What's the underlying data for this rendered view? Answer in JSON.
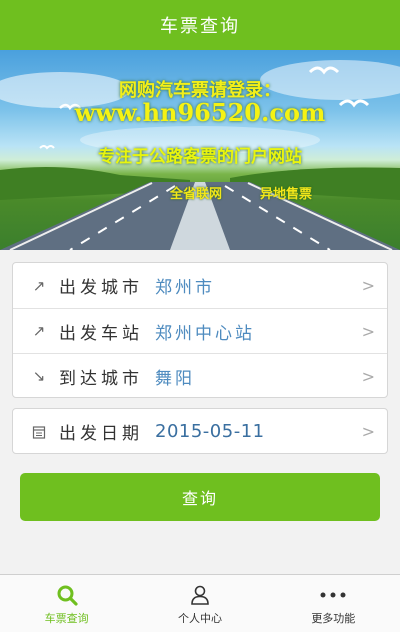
{
  "header": {
    "title": "车票查询"
  },
  "banner": {
    "line1": "网购汽车票请登录：",
    "line2": "www.hn96520.com",
    "line3": "专注于公路客票的门户网站",
    "tag1": "全省联网",
    "tag2": "异地售票"
  },
  "form": {
    "rows": [
      {
        "icon": "arrow-up-right-icon",
        "label": "出发城市",
        "value": "郑州市"
      },
      {
        "icon": "arrow-up-right-icon",
        "label": "出发车站",
        "value": "郑州中心站"
      },
      {
        "icon": "arrow-down-right-icon",
        "label": "到达城市",
        "value": "舞阳"
      }
    ],
    "date": {
      "icon": "calendar-icon",
      "label": "出发日期",
      "value": "2015-05-11"
    },
    "chevron": ">"
  },
  "query_button": {
    "label": "查询"
  },
  "tabbar": {
    "items": [
      {
        "icon": "search-icon",
        "label": "车票查询",
        "active": true
      },
      {
        "icon": "person-icon",
        "label": "个人中心",
        "active": false
      },
      {
        "icon": "more-icon",
        "label": "更多功能",
        "active": false
      }
    ]
  },
  "colors": {
    "brand_green": "#6fbf1f",
    "value_blue": "#4e8bbf"
  }
}
